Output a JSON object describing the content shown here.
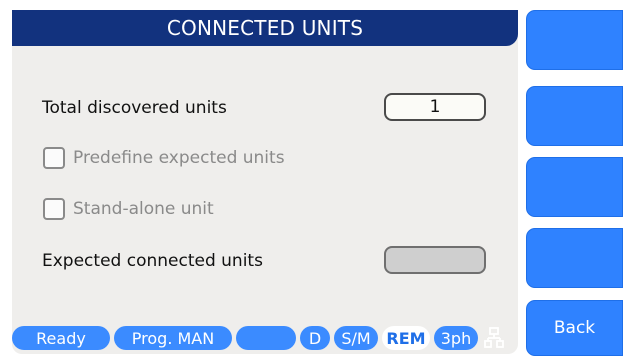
{
  "header": {
    "title": "CONNECTED UNITS"
  },
  "rows": {
    "total_discovered": {
      "label": "Total discovered units",
      "value": "1"
    },
    "predefine": {
      "label": "Predefine expected units",
      "checked": false
    },
    "standalone": {
      "label": "Stand-alone unit",
      "checked": false
    },
    "expected_connected": {
      "label": "Expected connected units",
      "value": ""
    }
  },
  "softkeys": [
    {
      "label": ""
    },
    {
      "label": ""
    },
    {
      "label": ""
    },
    {
      "label": ""
    },
    {
      "label": "Back"
    }
  ],
  "status_bar": {
    "ready": "Ready",
    "prog": "Prog. MAN",
    "blank": "",
    "d": "D",
    "sm": "S/M",
    "rem": "REM",
    "phase": "3ph",
    "network_icon": "network-tree-icon"
  },
  "colors": {
    "title_bar": "#12327e",
    "softkey": "#2f82ff",
    "status_chip": "#3b8bff",
    "panel": "#efeeec"
  }
}
